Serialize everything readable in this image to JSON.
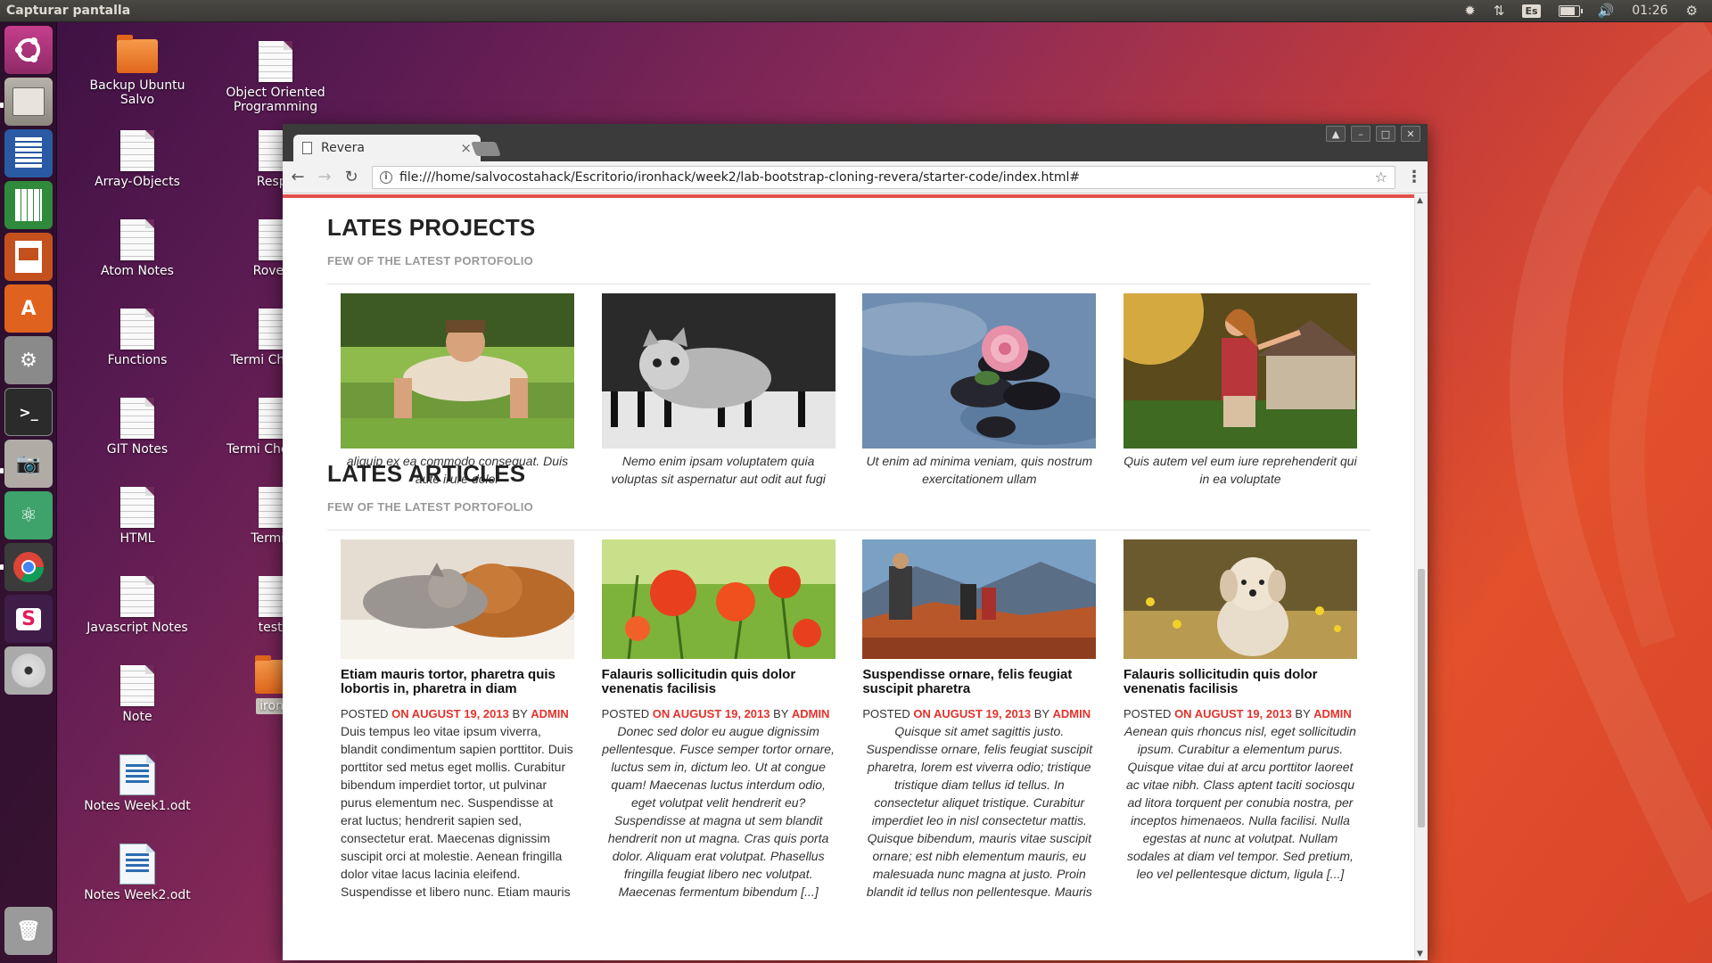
{
  "topbar": {
    "app_title": "Capturar pantalla",
    "language": "Es",
    "clock": "01:26"
  },
  "launcher": {
    "items": [
      "Ubuntu Dash",
      "Files",
      "LibreOffice Writer",
      "LibreOffice Calc",
      "LibreOffice Impress",
      "Ubuntu Software",
      "System Settings",
      "Terminal",
      "Screenshot",
      "Atom",
      "Google Chrome",
      "Slack",
      "DVD",
      "Trash"
    ]
  },
  "desktop": {
    "icons": [
      {
        "label": "Backup Ubuntu Salvo",
        "type": "folder"
      },
      {
        "label": "Array-Objects",
        "type": "doc"
      },
      {
        "label": "Atom Notes",
        "type": "doc"
      },
      {
        "label": "Functions",
        "type": "doc"
      },
      {
        "label": "GIT Notes",
        "type": "doc"
      },
      {
        "label": "HTML",
        "type": "doc"
      },
      {
        "label": "Javascript Notes",
        "type": "doc"
      },
      {
        "label": "Note",
        "type": "doc"
      },
      {
        "label": "Notes Week1.odt",
        "type": "odt"
      },
      {
        "label": "Notes Week2.odt",
        "type": "odt"
      },
      {
        "label": "Object Oriented Programming",
        "type": "doc"
      },
      {
        "label": "Respo",
        "type": "doc"
      },
      {
        "label": "RoverN",
        "type": "doc"
      },
      {
        "label": "Termi CheatSh",
        "type": "doc"
      },
      {
        "label": "Termi CheatShe",
        "type": "doc"
      },
      {
        "label": "Termina",
        "type": "doc"
      },
      {
        "label": "test.s",
        "type": "doc"
      },
      {
        "label": "ironh",
        "type": "folder"
      }
    ]
  },
  "browser": {
    "tab_title": "Revera",
    "url": "file:///home/salvocostahack/Escritorio/ironhack/week2/lab-bootstrap-cloning-revera/starter-code/index.html#"
  },
  "projects": {
    "title": "LATES PROJECTS",
    "subtitle": "FEW OF THE LATEST PORTOFOLIO",
    "items": [
      {
        "caption": "aliquip ex ea commodo consequat. Duis aute irure dolor",
        "image": "man doing push-ups on grass"
      },
      {
        "caption": "Nemo enim ipsam voluptatem quia voluptas sit aspernatur aut odit aut fugi",
        "image": "kitten on piano keys (black and white)"
      },
      {
        "caption": "Ut enim ad minima veniam, quis nostrum exercitationem ullam",
        "image": "pink rose on black stones in water"
      },
      {
        "caption": "Quis autem vel eum iure reprehenderit qui in ea voluptate",
        "image": "woman in plaid shirt in sunlight"
      }
    ]
  },
  "articles": {
    "title": "LATES ARTICLES",
    "subtitle": "FEW OF THE LATEST PORTOFOLIO",
    "posted_label": "POSTED",
    "by_label": "BY",
    "items": [
      {
        "title": "Etiam mauris tortor, pharetra quis lobortis in, pharetra in diam",
        "date": "ON AUGUST 19, 2013",
        "author": "ADMIN",
        "excerpt": "Duis tempus leo vitae ipsum viverra, blandit condimentum sapien porttitor. Duis porttitor sed metus eget mollis. Curabitur bibendum imperdiet tortor, ut pulvinar purus elementum nec. Suspendisse at erat luctus; hendrerit sapien sed, consectetur erat. Maecenas dignissim suscipit orci at molestie. Aenean fringilla dolor vitae lacus lacinia eleifend. Suspendisse et libero nunc. Etiam mauris",
        "image": "kitten and puppy sleeping"
      },
      {
        "title": "Falauris sollicitudin quis dolor venenatis facilisis",
        "date": "ON AUGUST 19, 2013",
        "author": "ADMIN",
        "excerpt": "Donec sed dolor eu augue dignissim pellentesque. Fusce semper tortor ornare, luctus sem in, dictum leo. Ut at congue quam! Maecenas luctus interdum odio, eget volutpat velit hendrerit eu? Suspendisse at magna ut sem blandit hendrerit non ut magna. Cras quis porta dolor. Aliquam erat volutpat. Phasellus fringilla feugiat libero nec volutpat. Maecenas fermentum bibendum [...]",
        "image": "red poppies in field"
      },
      {
        "title": "Suspendisse ornare, felis feugiat suscipit pharetra",
        "date": "ON AUGUST 19, 2013",
        "author": "ADMIN",
        "excerpt": "Quisque sit amet sagittis justo. Suspendisse ornare, felis feugiat suscipit pharetra, lorem est viverra odio; tristique tristique diam tellus id tellus. In consectetur aliquet tristique. Curabitur imperdiet leo in nisl consectetur mattis. Quisque bibendum, mauris vitae suscipit ornare; est nibh elementum mauris, eu malesuada nunc magna at justo. Proin blandit id tellus non pellentesque. Mauris",
        "image": "hikers on mountain trail"
      },
      {
        "title": "Falauris sollicitudin quis dolor venenatis facilisis",
        "date": "ON AUGUST 19, 2013",
        "author": "ADMIN",
        "excerpt": "Aenean quis rhoncus nisl, eget sollicitudin ipsum. Curabitur a elementum purus. Quisque vitae dui at arcu porttitor laoreet ac vitae nibh. Class aptent taciti sociosqu ad litora torquent per conubia nostra, per inceptos himenaeos. Nulla facilisi. Nulla egestas at nunc at volutpat. Nullam sodales at diam vel tempor. Sed pretium, leo vel pellentesque dictum, ligula [...]",
        "image": "fluffy puppy among flowers"
      }
    ]
  },
  "colors": {
    "accent_red": "#e3322b",
    "brand_bar": "#e3504c",
    "subtitle_gray": "#999999"
  }
}
